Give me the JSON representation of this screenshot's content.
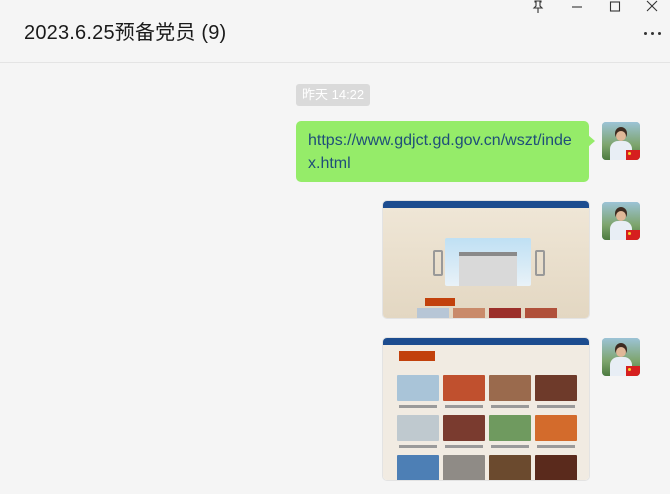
{
  "window": {
    "title": "2023.6.25预备党员 (9)",
    "controls": [
      "pin-icon",
      "minimize-icon",
      "maximize-icon",
      "close-icon"
    ],
    "more_icon": "more-icon"
  },
  "chat": {
    "timestamp": "昨天 14:22",
    "messages": [
      {
        "type": "text",
        "text": "https://www.gdjct.gd.gov.cn/wszt/index.html"
      },
      {
        "type": "image",
        "description_icon": "webpage-screenshot"
      },
      {
        "type": "image",
        "description_icon": "webpage-screenshot"
      }
    ]
  },
  "colors": {
    "bubble": "#95ec69",
    "link_text": "#1f4e79",
    "background": "#f5f5f5"
  }
}
